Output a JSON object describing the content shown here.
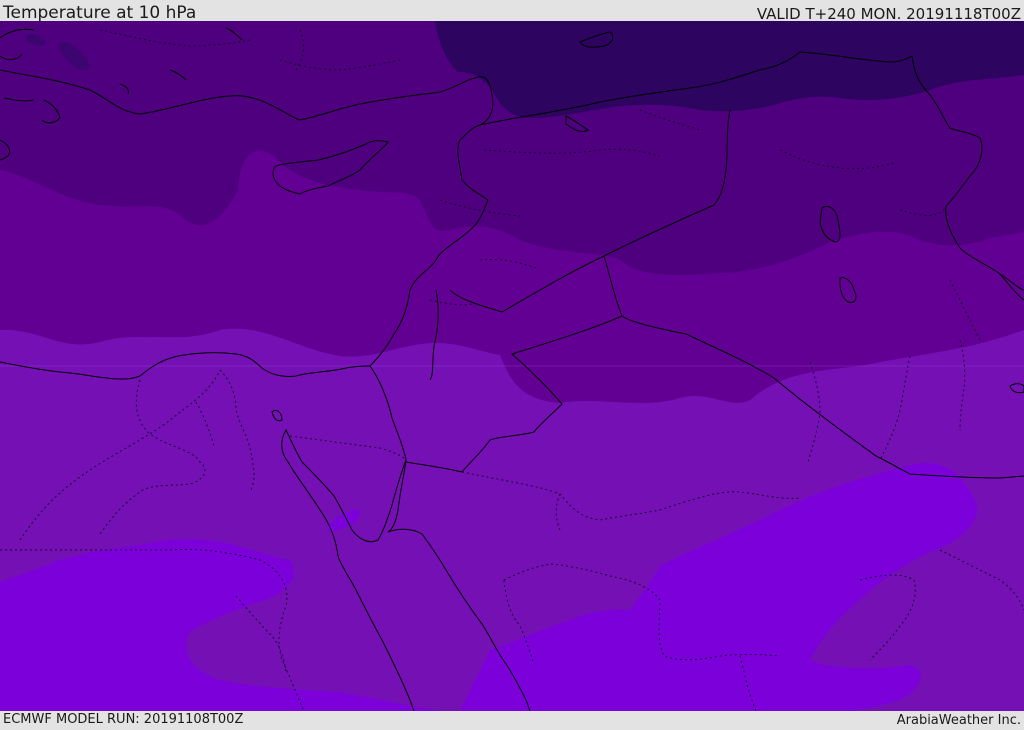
{
  "header": {
    "title": "Temperature at 10 hPa",
    "valid": "VALID T+240 MON. 20191118T00Z"
  },
  "footer": {
    "model_run": "ECMWF MODEL RUN: 20191108T00Z",
    "credit": "ArabiaWeather Inc."
  },
  "map": {
    "region": "Eastern Mediterranean / Middle East",
    "field": "Temperature at 10 hPa",
    "colors": {
      "band_coldest": "#2d0560",
      "band_cold": "#4f007f",
      "band_mid": "#620093",
      "band_mild": "#7511b4",
      "band_warm": "#7c00da",
      "coast_border": "#000000"
    }
  }
}
